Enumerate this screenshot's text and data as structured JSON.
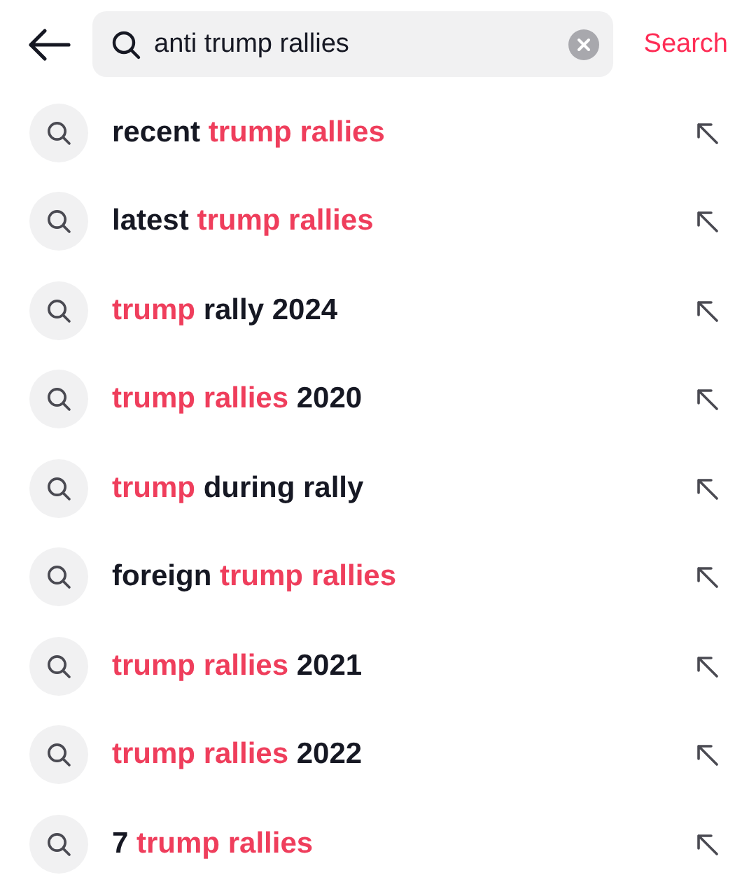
{
  "search_bar": {
    "value": "anti trump rallies",
    "action": "Search"
  },
  "suggestions": [
    {
      "segments": [
        {
          "text": "recent ",
          "highlight": false
        },
        {
          "text": "trump rallies",
          "highlight": true
        }
      ]
    },
    {
      "segments": [
        {
          "text": "latest ",
          "highlight": false
        },
        {
          "text": "trump rallies",
          "highlight": true
        }
      ]
    },
    {
      "segments": [
        {
          "text": "trump",
          "highlight": true
        },
        {
          "text": " rally 2024",
          "highlight": false
        }
      ]
    },
    {
      "segments": [
        {
          "text": "trump rallies",
          "highlight": true
        },
        {
          "text": " 2020",
          "highlight": false
        }
      ]
    },
    {
      "segments": [
        {
          "text": "trump",
          "highlight": true
        },
        {
          "text": " during rally",
          "highlight": false
        }
      ]
    },
    {
      "segments": [
        {
          "text": "foreign ",
          "highlight": false
        },
        {
          "text": "trump rallies",
          "highlight": true
        }
      ]
    },
    {
      "segments": [
        {
          "text": "trump rallies",
          "highlight": true
        },
        {
          "text": " 2021",
          "highlight": false
        }
      ]
    },
    {
      "segments": [
        {
          "text": "trump rallies",
          "highlight": true
        },
        {
          "text": " 2022",
          "highlight": false
        }
      ]
    },
    {
      "segments": [
        {
          "text": "7 ",
          "highlight": false
        },
        {
          "text": "trump rallies",
          "highlight": true
        }
      ]
    }
  ]
}
